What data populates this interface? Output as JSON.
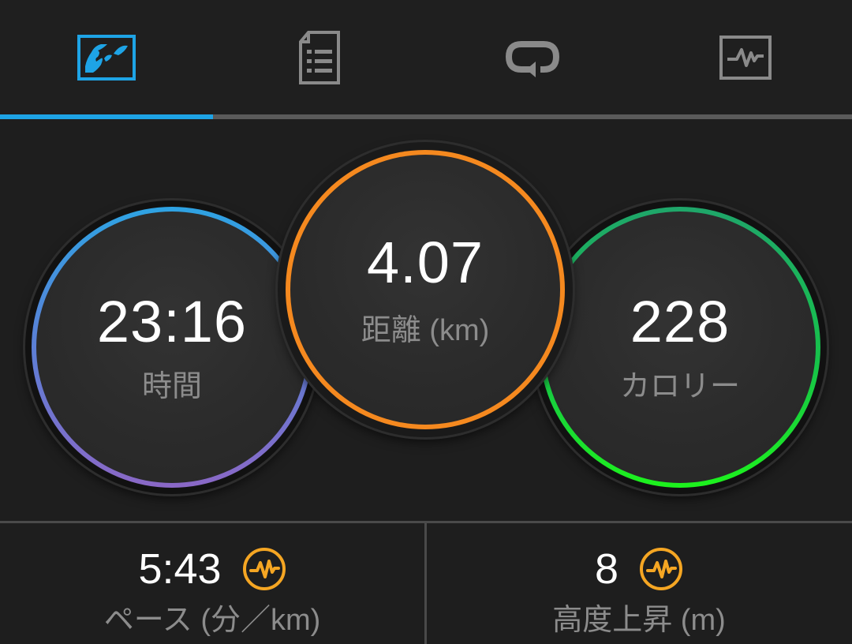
{
  "tabs": [
    {
      "icon": "activity-overview-icon",
      "active": true
    },
    {
      "icon": "details-list-icon",
      "active": false
    },
    {
      "icon": "laps-loop-icon",
      "active": false
    },
    {
      "icon": "graph-chart-icon",
      "active": false
    }
  ],
  "colors": {
    "accent": "#1ea4e6",
    "time_ring": "#2ea3e3",
    "distance_ring": "#f5891f",
    "calories_ring": "#1df21d",
    "pulse_icon": "#f5a623"
  },
  "stats": {
    "time": {
      "value": "23:16",
      "label": "時間"
    },
    "distance": {
      "value": "4.07",
      "label": "距離 (km)"
    },
    "calories": {
      "value": "228",
      "label": "カロリー"
    }
  },
  "bottom": {
    "pace": {
      "value": "5:43",
      "label": "ペース (分／km)",
      "icon": "pulse-icon"
    },
    "elevation": {
      "value": "8",
      "label": "高度上昇 (m)",
      "icon": "pulse-icon"
    }
  }
}
